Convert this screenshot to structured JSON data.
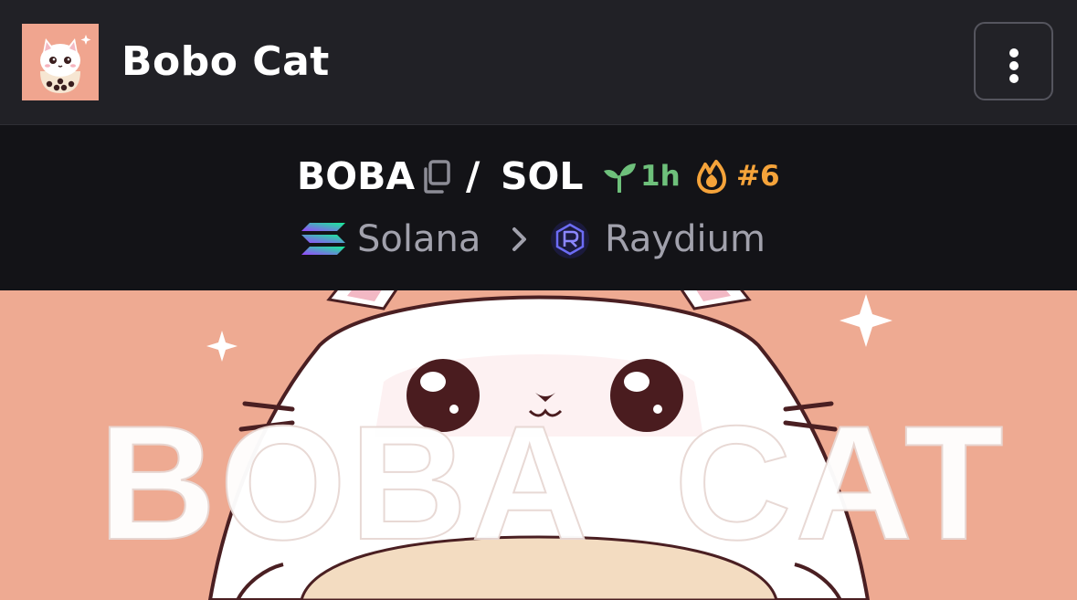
{
  "header": {
    "token_name": "Bobo Cat",
    "avatar_icon": "bobo-cat-avatar",
    "menu_icon": "vertical-ellipsis-icon"
  },
  "pair": {
    "base_symbol": "BOBA",
    "separator": "/",
    "quote_symbol": "SOL",
    "age": "1h",
    "rank": "#6",
    "age_color": "#6ec07b",
    "rank_color": "#f5a33a"
  },
  "chain": {
    "name": "Solana",
    "dex": "Raydium"
  },
  "banner": {
    "text_left": "BOBA",
    "text_right": "CAT",
    "background_color": "#eeaa92"
  },
  "colors": {
    "header_bg": "#212126",
    "pairbar_bg": "#131317",
    "muted_text": "#a1a1ac"
  }
}
